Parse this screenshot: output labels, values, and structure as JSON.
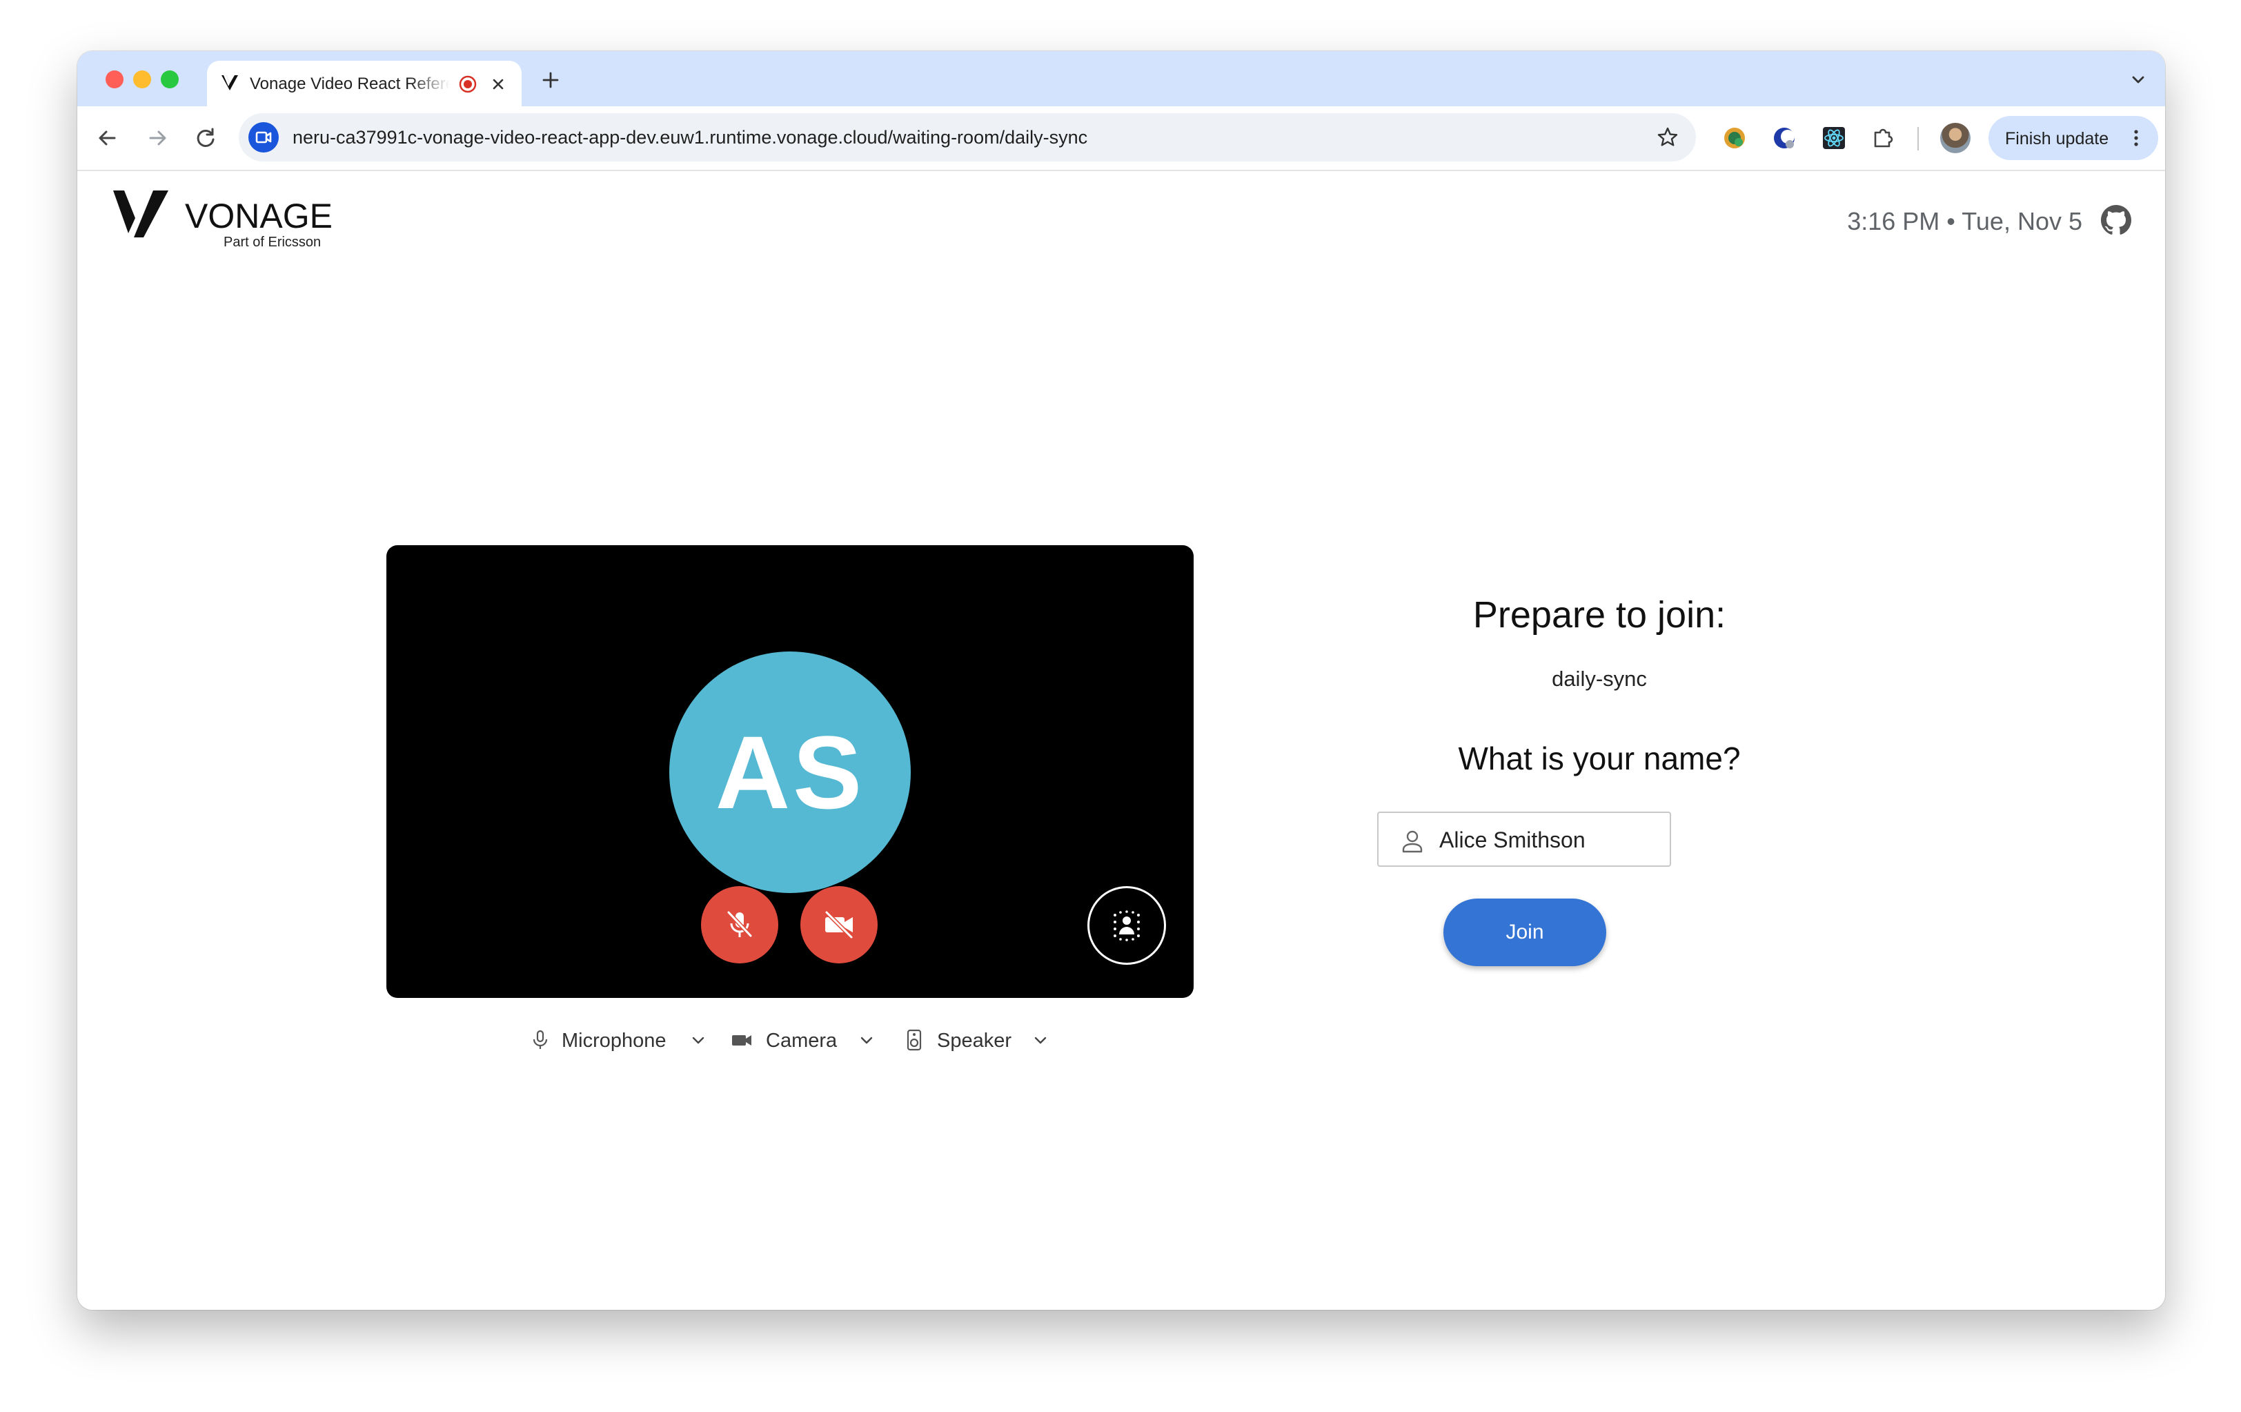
{
  "browser": {
    "tab": {
      "title": "Vonage Video React Reference App",
      "favicon": "vonage-v-icon",
      "recording_indicator": "record-icon",
      "close_icon": "close-icon"
    },
    "new_tab_icon": "plus-icon",
    "tab_search_icon": "chevron-down-icon",
    "url": "neru-ca37991c-vonage-video-react-app-dev.euw1.runtime.vonage.cloud/waiting-room/daily-sync",
    "finish_update_label": "Finish update",
    "extensions": [
      "extension-icon-1",
      "extension-icon-2",
      "react-devtools-icon",
      "puzzle-icon"
    ]
  },
  "header": {
    "brand": "VONAGE",
    "brand_sub": "Part of Ericsson",
    "datetime": "3:16 PM • Tue, Nov 5"
  },
  "preview": {
    "initials": "AS",
    "avatar_color": "#56b9d3",
    "mic_muted": true,
    "camera_off": true,
    "control_color": "#df4b3c"
  },
  "devices": {
    "microphone": "Microphone",
    "camera": "Camera",
    "speaker": "Speaker"
  },
  "join_panel": {
    "title": "Prepare to join:",
    "room": "daily-sync",
    "name_question": "What is your name?",
    "name_value": "Alice Smithson",
    "join_label": "Join",
    "join_color": "#3474d4"
  }
}
